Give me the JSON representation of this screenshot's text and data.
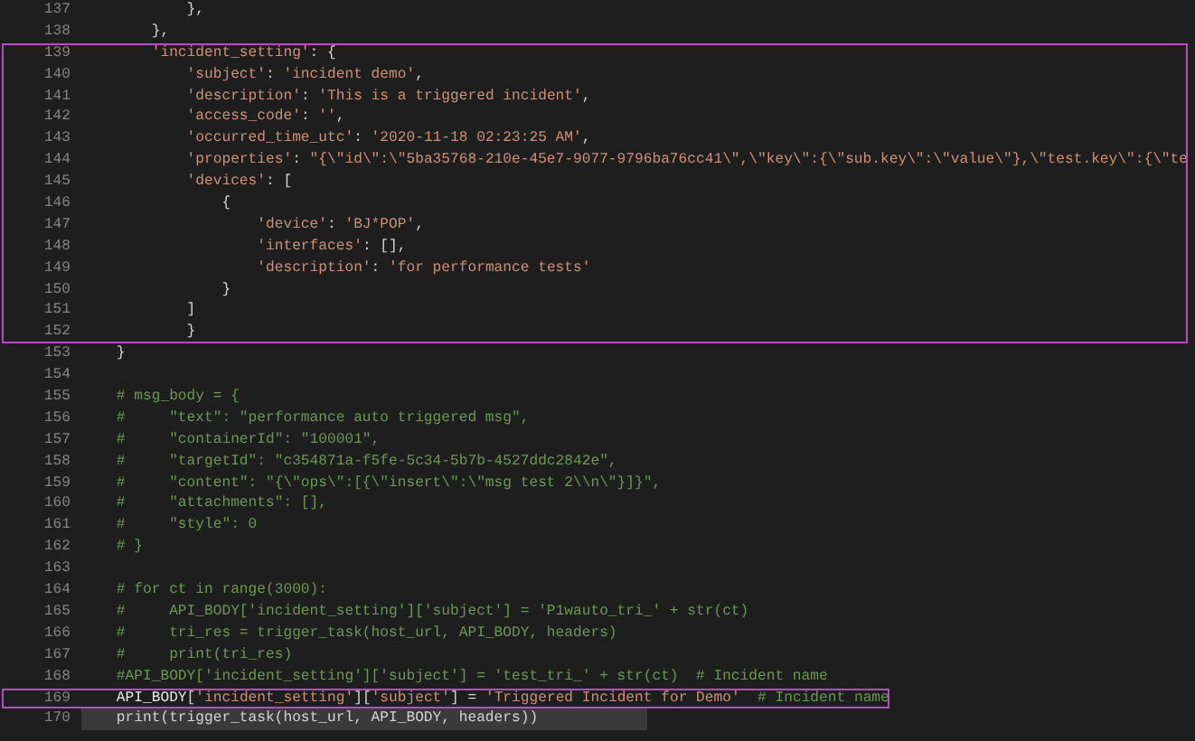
{
  "editor": {
    "blocks": [
      {
        "highlighted": false,
        "lines": [
          {
            "number": "137",
            "current": false,
            "tokens": [
              {
                "kind": "punct",
                "text": "            },"
              }
            ]
          },
          {
            "number": "138",
            "current": false,
            "tokens": [
              {
                "kind": "punct",
                "text": "        },"
              }
            ]
          }
        ]
      },
      {
        "highlighted": true,
        "lines": [
          {
            "number": "139",
            "current": false,
            "tokens": [
              {
                "kind": "str",
                "text": "        'incident_setting'"
              },
              {
                "kind": "punct",
                "text": ": {"
              }
            ]
          },
          {
            "number": "140",
            "current": false,
            "tokens": [
              {
                "kind": "str",
                "text": "            'subject'"
              },
              {
                "kind": "punct",
                "text": ": "
              },
              {
                "kind": "str",
                "text": "'incident demo'"
              },
              {
                "kind": "punct",
                "text": ","
              }
            ]
          },
          {
            "number": "141",
            "current": false,
            "tokens": [
              {
                "kind": "str",
                "text": "            'description'"
              },
              {
                "kind": "punct",
                "text": ": "
              },
              {
                "kind": "str",
                "text": "'This is a triggered incident'"
              },
              {
                "kind": "punct",
                "text": ","
              }
            ]
          },
          {
            "number": "142",
            "current": false,
            "tokens": [
              {
                "kind": "str",
                "text": "            'access_code'"
              },
              {
                "kind": "punct",
                "text": ": "
              },
              {
                "kind": "str",
                "text": "''"
              },
              {
                "kind": "punct",
                "text": ","
              }
            ]
          },
          {
            "number": "143",
            "current": false,
            "tokens": [
              {
                "kind": "str",
                "text": "            'occurred_time_utc'"
              },
              {
                "kind": "punct",
                "text": ": "
              },
              {
                "kind": "str",
                "text": "'2020-11-18 02:23:25 AM'"
              },
              {
                "kind": "punct",
                "text": ","
              }
            ]
          },
          {
            "number": "144",
            "current": false,
            "tokens": [
              {
                "kind": "str",
                "text": "            'properties'"
              },
              {
                "kind": "punct",
                "text": ": "
              },
              {
                "kind": "str",
                "text": "\"{\\\"id\\\":\\\"5ba35768-210e-45e7-9077-9796ba76cc41\\\",\\\"key\\\":{\\\"sub.key\\\":\\\"value\\\"},\\\"test.key\\\":{\\\"te"
              }
            ]
          },
          {
            "number": "145",
            "current": false,
            "tokens": [
              {
                "kind": "str",
                "text": "            'devices'"
              },
              {
                "kind": "punct",
                "text": ": ["
              }
            ]
          },
          {
            "number": "146",
            "current": false,
            "tokens": [
              {
                "kind": "punct",
                "text": "                {"
              }
            ]
          },
          {
            "number": "147",
            "current": false,
            "tokens": [
              {
                "kind": "str",
                "text": "                    'device'"
              },
              {
                "kind": "punct",
                "text": ": "
              },
              {
                "kind": "str",
                "text": "'BJ*POP'"
              },
              {
                "kind": "punct",
                "text": ","
              }
            ]
          },
          {
            "number": "148",
            "current": false,
            "tokens": [
              {
                "kind": "str",
                "text": "                    'interfaces'"
              },
              {
                "kind": "punct",
                "text": ": [],"
              }
            ]
          },
          {
            "number": "149",
            "current": false,
            "tokens": [
              {
                "kind": "str",
                "text": "                    'description'"
              },
              {
                "kind": "punct",
                "text": ": "
              },
              {
                "kind": "str",
                "text": "'for performance tests'"
              }
            ]
          },
          {
            "number": "150",
            "current": false,
            "tokens": [
              {
                "kind": "punct",
                "text": "                }"
              }
            ]
          },
          {
            "number": "151",
            "current": false,
            "tokens": [
              {
                "kind": "punct",
                "text": "            ]"
              }
            ]
          },
          {
            "number": "152",
            "current": false,
            "tokens": [
              {
                "kind": "punct",
                "text": "            }"
              }
            ]
          }
        ]
      },
      {
        "highlighted": false,
        "lines": [
          {
            "number": "153",
            "current": false,
            "tokens": [
              {
                "kind": "punct",
                "text": "    }"
              }
            ]
          },
          {
            "number": "154",
            "current": false
          },
          {
            "number": "155",
            "current": false,
            "tokens": [
              {
                "kind": "comment",
                "text": "    # msg_body = {"
              }
            ]
          },
          {
            "number": "156",
            "current": false,
            "tokens": [
              {
                "kind": "comment",
                "text": "    #     \"text\": \"performance auto triggered msg\","
              }
            ]
          },
          {
            "number": "157",
            "current": false,
            "tokens": [
              {
                "kind": "comment",
                "text": "    #     \"containerId\": \"100001\","
              }
            ]
          },
          {
            "number": "158",
            "current": false,
            "tokens": [
              {
                "kind": "comment",
                "text": "    #     \"targetId\": \"c354871a-f5fe-5c34-5b7b-4527ddc2842e\","
              }
            ]
          },
          {
            "number": "159",
            "current": false,
            "tokens": [
              {
                "kind": "comment",
                "text": "    #     \"content\": \"{\\\"ops\\\":[{\\\"insert\\\":\\\"msg test 2\\\\n\\\"}]}\","
              }
            ]
          },
          {
            "number": "160",
            "current": false,
            "tokens": [
              {
                "kind": "comment",
                "text": "    #     \"attachments\": [],"
              }
            ]
          },
          {
            "number": "161",
            "current": false,
            "tokens": [
              {
                "kind": "comment",
                "text": "    #     \"style\": 0"
              }
            ]
          },
          {
            "number": "162",
            "current": false,
            "tokens": [
              {
                "kind": "comment",
                "text": "    # }"
              }
            ]
          },
          {
            "number": "163",
            "current": false
          },
          {
            "number": "164",
            "current": false,
            "tokens": [
              {
                "kind": "comment",
                "text": "    # for ct in range(3000):"
              }
            ]
          },
          {
            "number": "165",
            "current": false,
            "tokens": [
              {
                "kind": "comment",
                "text": "    #     API_BODY['incident_setting']['subject'] = 'P1wauto_tri_' + str(ct)"
              }
            ]
          },
          {
            "number": "166",
            "current": false,
            "tokens": [
              {
                "kind": "comment",
                "text": "    #     tri_res = trigger_task(host_url, API_BODY, headers)"
              }
            ]
          },
          {
            "number": "167",
            "current": false,
            "tokens": [
              {
                "kind": "comment",
                "text": "    #     print(tri_res)"
              }
            ]
          },
          {
            "number": "168",
            "current": false,
            "tokens": [
              {
                "kind": "comment",
                "text": "    #API_BODY['incident_setting']['subject'] = 'test_tri_' + str(ct)  # Incident name"
              }
            ]
          }
        ]
      },
      {
        "highlighted": true,
        "lines": [
          {
            "number": "169",
            "current": false,
            "tokens": [
              {
                "kind": "var",
                "text": "    API_BODY"
              },
              {
                "kind": "punct",
                "text": "["
              },
              {
                "kind": "str",
                "text": "'incident_setting'"
              },
              {
                "kind": "punct",
                "text": "]["
              },
              {
                "kind": "str",
                "text": "'subject'"
              },
              {
                "kind": "punct",
                "text": "] = "
              },
              {
                "kind": "str",
                "text": "'Triggered Incident for Demo'"
              },
              {
                "kind": "comment",
                "text": "  # Incident name"
              }
            ]
          }
        ]
      },
      {
        "highlighted": false,
        "lines": [
          {
            "number": "170",
            "current": true,
            "tokens": [
              {
                "kind": "punct",
                "text": "    print(trigger_task(host_url, API_BODY, headers))"
              }
            ]
          }
        ]
      }
    ]
  }
}
